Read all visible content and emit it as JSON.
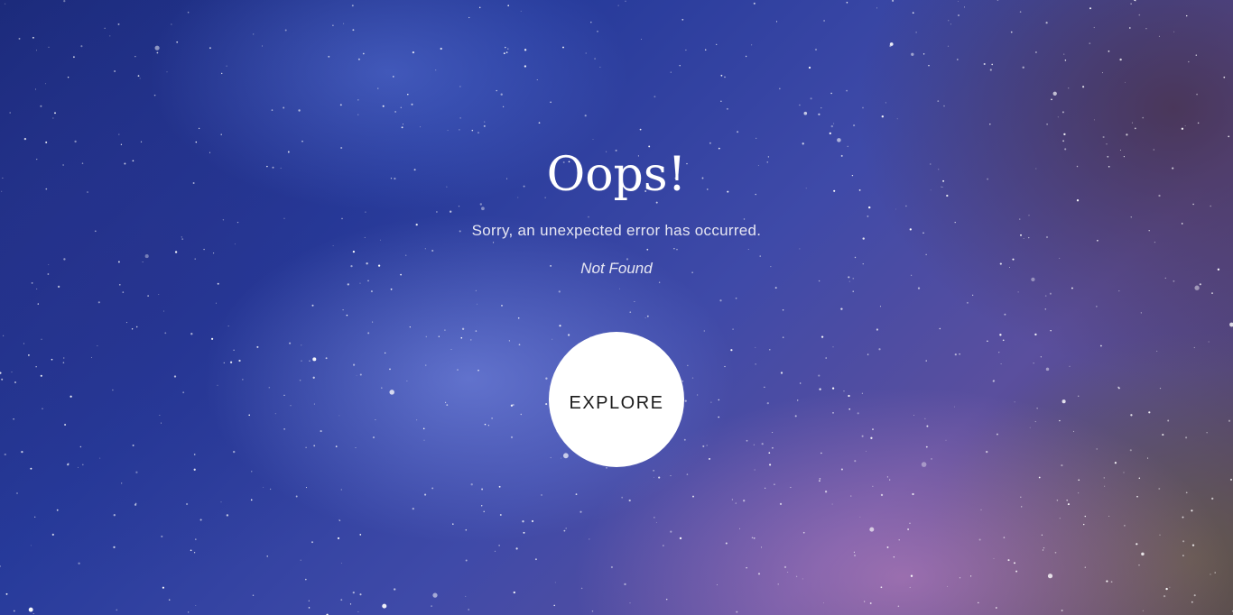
{
  "page": {
    "title": "Oops!",
    "message": "Sorry, an unexpected error has occurred.",
    "error_status": "Not Found"
  },
  "actions": {
    "explore_label": "EXPLORE"
  },
  "colors": {
    "text": "#ffffff",
    "subtext": "#e6e6f2",
    "button_bg": "#ffffff",
    "button_text": "#1a1a1a",
    "background_deep": "#1b2a7a",
    "background_nebula": "#5a4f9e"
  }
}
